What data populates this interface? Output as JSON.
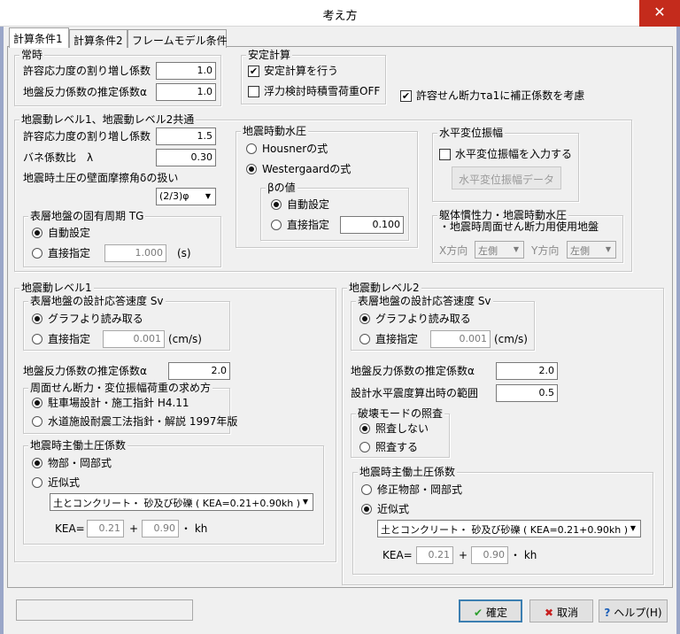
{
  "window": {
    "title": "考え方",
    "close": "✕"
  },
  "tabs": [
    "計算条件1",
    "計算条件2",
    "フレームモデル条件"
  ],
  "normal": {
    "title": "常時",
    "stress_factor": {
      "label": "許容応力度の割り増し係数",
      "value": "1.0"
    },
    "soil_reaction": {
      "label": "地盤反力係数の推定係数α",
      "value": "1.0"
    }
  },
  "stability": {
    "title": "安定計算",
    "do_calc": {
      "label": "安定計算を行う",
      "checked": true
    },
    "buoyancy": {
      "label": "浮力検討時積雪荷重OFF",
      "checked": false
    }
  },
  "shear_correction": {
    "label": "許容せん断力τa1に補正係数を考慮",
    "checked": true
  },
  "common": {
    "title": "地震動レベル1、地震動レベル2共通",
    "stress_factor": {
      "label": "許容応力度の割り増し係数",
      "value": "1.5"
    },
    "poisson": {
      "label": "バネ係数比　λ",
      "value": "0.30"
    },
    "friction": {
      "label": "地震時土圧の壁面摩擦角δの扱い",
      "value": "(2/3)φ"
    },
    "period": {
      "title": "表層地盤の固有周期 TG",
      "auto": "自動設定",
      "direct": "直接指定",
      "value": "1.000",
      "unit": "(s)"
    }
  },
  "hydro": {
    "title": "地震時動水圧",
    "housner": "Housnerの式",
    "westergaard": "Westergaardの式",
    "beta": {
      "title": "βの値",
      "auto": "自動設定",
      "direct": "直接指定",
      "value": "0.100"
    }
  },
  "displacement": {
    "title": "水平変位振幅",
    "input": {
      "label": "水平変位振幅を入力する",
      "checked": false
    },
    "data_button": "水平変位振幅データ"
  },
  "body_rigidity": {
    "title_line1": "躯体慣性力・地震時動水圧",
    "title_line2": "・地震時周面せん断力用使用地盤",
    "x_label": "X方向",
    "x_value": "左側",
    "y_label": "Y方向",
    "y_value": "左側"
  },
  "level1": {
    "title": "地震動レベル1",
    "sv": {
      "title": "表層地盤の設計応答速度 Sv",
      "graph": "グラフより読み取る",
      "direct": "直接指定",
      "value": "0.001",
      "unit": "(cm/s)"
    },
    "soil_reaction": {
      "label": "地盤反力係数の推定係数α",
      "value": "2.0"
    },
    "shear_method": {
      "title": "周面せん断力・変位振幅荷重の求め方",
      "opt1": "駐車場設計・施工指針 H4.11",
      "opt2": "水道施設耐震工法指針・解説 1997年版"
    },
    "active_pressure": {
      "title": "地震時主働土圧係数",
      "opt1": "物部・岡部式",
      "opt2": "近似式",
      "soil_type": "土とコンクリート・ 砂及び砂礫 ( KEA=0.21+0.90kh )",
      "kea_label": "KEA=",
      "kea_a": "0.21",
      "plus": "+",
      "kea_b": "0.90",
      "kh": "・ kh"
    }
  },
  "level2": {
    "title": "地震動レベル2",
    "sv": {
      "title": "表層地盤の設計応答速度 Sv",
      "graph": "グラフより読み取る",
      "direct": "直接指定",
      "value": "0.001",
      "unit": "(cm/s)"
    },
    "soil_reaction": {
      "label": "地盤反力係数の推定係数α",
      "value": "2.0"
    },
    "seismic_range": {
      "label": "設計水平震度算出時の範囲",
      "value": "0.5"
    },
    "failure_mode": {
      "title": "破壊モードの照査",
      "opt1": "照査しない",
      "opt2": "照査する"
    },
    "active_pressure": {
      "title": "地震時主働土圧係数",
      "opt1": "修正物部・岡部式",
      "opt2": "近似式",
      "soil_type": "土とコンクリート・ 砂及び砂礫 ( KEA=0.21+0.90kh )",
      "kea_label": "KEA=",
      "kea_a": "0.21",
      "plus": "+",
      "kea_b": "0.90",
      "kh": "・ kh"
    }
  },
  "footer": {
    "ok": "確定",
    "cancel": "取消",
    "help": "ヘルプ(H)"
  }
}
